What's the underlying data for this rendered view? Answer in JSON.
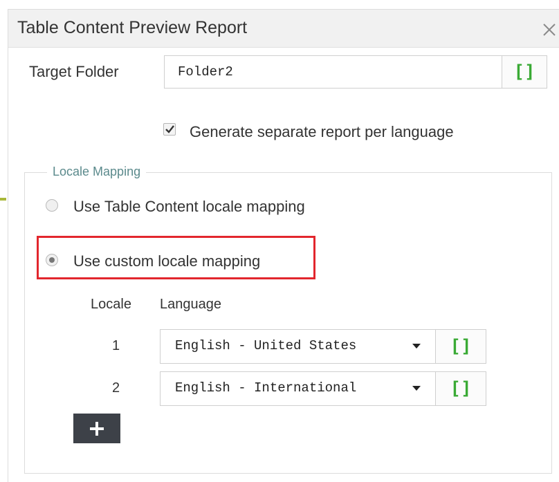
{
  "dialog": {
    "title": "Table Content Preview Report"
  },
  "target_folder": {
    "label": "Target Folder",
    "value": "Folder2",
    "bracket_label": "[]"
  },
  "separate_report": {
    "label": "Generate separate report per language",
    "checked": true
  },
  "locale_mapping": {
    "legend": "Locale Mapping",
    "options": [
      {
        "label": "Use Table Content locale mapping",
        "selected": false
      },
      {
        "label": "Use custom locale mapping",
        "selected": true
      }
    ],
    "table": {
      "headers": {
        "locale": "Locale",
        "language": "Language"
      },
      "rows": [
        {
          "locale": "1",
          "language": "English - United States",
          "bracket_label": "[]"
        },
        {
          "locale": "2",
          "language": "English - International",
          "bracket_label": "[]"
        }
      ]
    },
    "add_label": "+"
  },
  "colors": {
    "accent_green": "#3aaa35",
    "highlight_red": "#e2262d",
    "legend_teal": "#5b8a8c",
    "add_button_bg": "#3d4148"
  }
}
